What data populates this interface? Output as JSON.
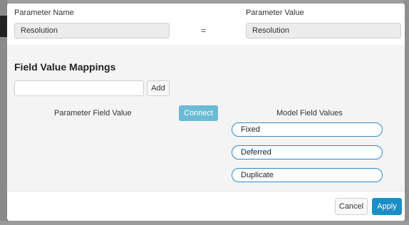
{
  "modal": {
    "parameter_name_label": "Parameter Name",
    "parameter_name_value": "Resolution",
    "equals_symbol": "=",
    "parameter_value_label": "Parameter Value",
    "parameter_value_value": "Resolution",
    "mappings_title": "Field Value Mappings",
    "add_input_value": "",
    "add_button_label": "Add",
    "parameter_field_value_header": "Parameter Field Value",
    "connect_button_label": "Connect",
    "model_field_values_header": "Model Field Values",
    "model_field_values": [
      "Fixed",
      "Deferred",
      "Duplicate"
    ],
    "cancel_label": "Cancel",
    "apply_label": "Apply"
  },
  "colors": {
    "primary": "#1b8ec6",
    "connect": "#6bbbd6",
    "pill_border": "#2f8ac9"
  }
}
